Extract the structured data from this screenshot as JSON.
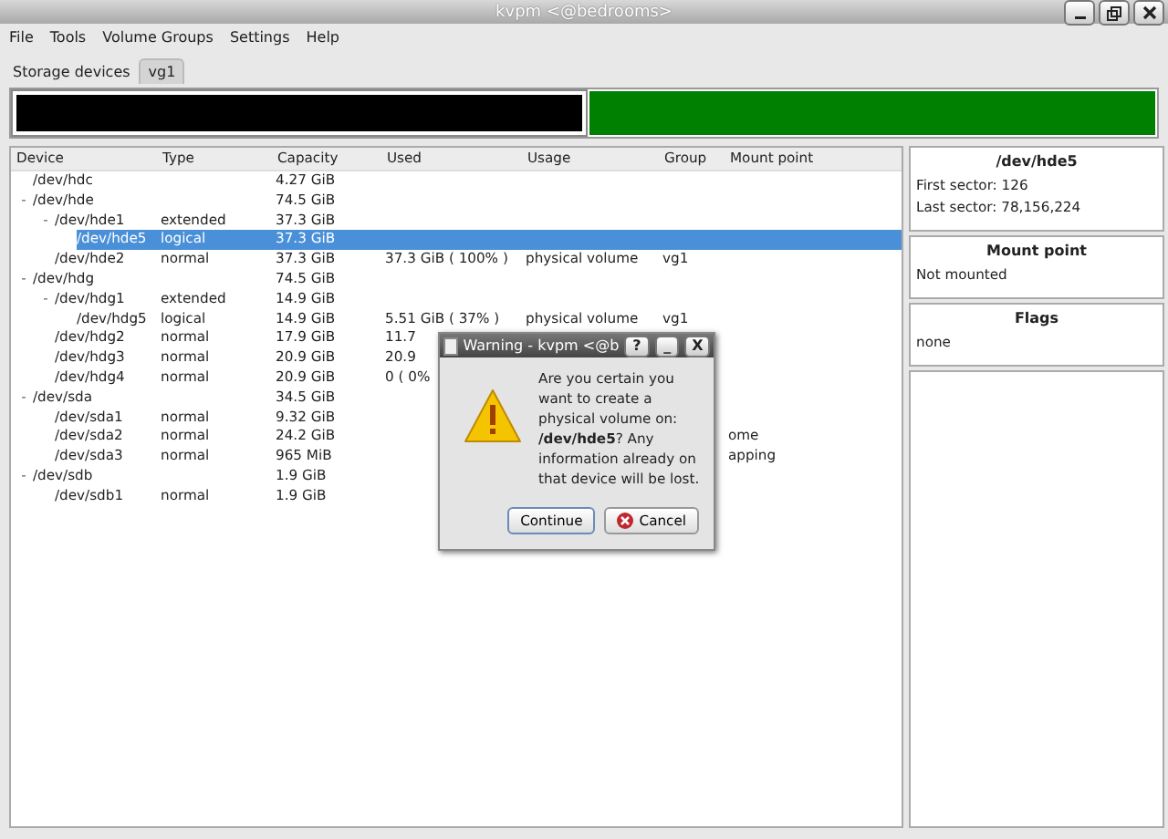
{
  "window": {
    "title": "kvpm <@bedrooms>"
  },
  "menu": [
    "File",
    "Tools",
    "Volume Groups",
    "Settings",
    "Help"
  ],
  "tabs": [
    {
      "label": "Storage devices",
      "selected": true
    },
    {
      "label": "vg1",
      "selected": false
    }
  ],
  "partition_bar": [
    {
      "color": "#000000",
      "selected": true
    },
    {
      "color": "#008000",
      "selected": false
    }
  ],
  "table": {
    "columns": [
      "Device",
      "Type",
      "Capacity",
      "Used",
      "Usage",
      "Group",
      "Mount point"
    ],
    "rows": [
      {
        "device": "/dev/hdc",
        "capacity": "4.27 GiB",
        "selected": false
      },
      {
        "device": "/dev/hde",
        "capacity": "74.5 GiB",
        "selected": false,
        "toggle": "-",
        "expanded": true,
        "children": [
          {
            "device": "/dev/hde1",
            "type": "extended",
            "capacity": "37.3 GiB",
            "selected": false,
            "toggle": "-",
            "expanded": true,
            "children": [
              {
                "device": "/dev/hde5",
                "type": "logical",
                "capacity": "37.3 GiB",
                "selected": true
              }
            ]
          },
          {
            "device": "/dev/hde2",
            "type": "normal",
            "capacity": "37.3 GiB",
            "used": "37.3 GiB ( 100% )",
            "usage": "physical volume",
            "group": "vg1",
            "selected": false
          }
        ]
      },
      {
        "device": "/dev/hdg",
        "capacity": "74.5 GiB",
        "selected": false,
        "toggle": "-",
        "expanded": true,
        "children": [
          {
            "device": "/dev/hdg1",
            "type": "extended",
            "capacity": "14.9 GiB",
            "selected": false,
            "toggle": "-",
            "expanded": true,
            "children": [
              {
                "device": "/dev/hdg5",
                "type": "logical",
                "capacity": "14.9 GiB",
                "used": "5.51 GiB ( 37% )",
                "usage": "physical volume",
                "group": "vg1",
                "selected": false
              }
            ]
          },
          {
            "device": "/dev/hdg2",
            "type": "normal",
            "capacity": "17.9 GiB",
            "used": "11.7",
            "selected": false
          },
          {
            "device": "/dev/hdg3",
            "type": "normal",
            "capacity": "20.9 GiB",
            "used": "20.9",
            "selected": false
          },
          {
            "device": "/dev/hdg4",
            "type": "normal",
            "capacity": "20.9 GiB",
            "used": "0 ( 0%",
            "selected": false
          }
        ]
      },
      {
        "device": "/dev/sda",
        "capacity": "34.5 GiB",
        "selected": false,
        "toggle": "-",
        "expanded": true,
        "children": [
          {
            "device": "/dev/sda1",
            "type": "normal",
            "capacity": "9.32 GiB",
            "selected": false
          },
          {
            "device": "/dev/sda2",
            "type": "normal",
            "capacity": "24.2 GiB",
            "mount": "ome",
            "selected": false
          },
          {
            "device": "/dev/sda3",
            "type": "normal",
            "capacity": "965 MiB",
            "mount": "apping",
            "selected": false
          }
        ]
      },
      {
        "device": "/dev/sdb",
        "capacity": "1.9 GiB",
        "selected": false,
        "toggle": "-",
        "expanded": true,
        "children": [
          {
            "device": "/dev/sdb1",
            "type": "normal",
            "capacity": "1.9 GiB",
            "selected": false
          }
        ]
      }
    ]
  },
  "details": [
    {
      "title": "/dev/hde5",
      "lines": [
        "First sector: 126",
        "Last sector: 78,156,224"
      ]
    },
    {
      "title": "Mount point",
      "lines": [
        "Not mounted"
      ]
    },
    {
      "title": "Flags",
      "lines": [
        "none"
      ]
    }
  ],
  "dialog": {
    "title": "Warning - kvpm <@b",
    "title_buttons": [
      "?",
      "_",
      "X"
    ],
    "message": "Are you certain you want to create a physical volume on: **/dev/hde5**? Any information already on that device will be lost.",
    "buttons": [
      "Continue",
      "Cancel"
    ]
  }
}
